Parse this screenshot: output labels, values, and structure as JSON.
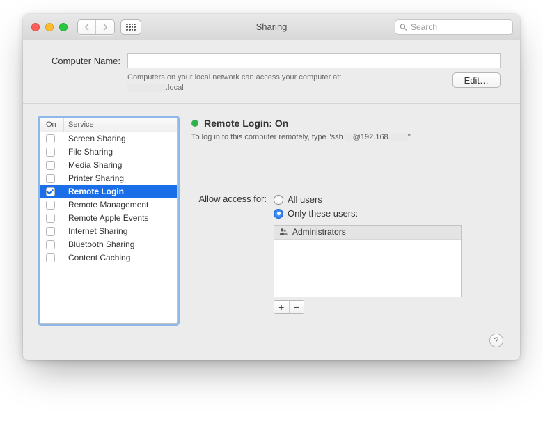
{
  "window": {
    "title": "Sharing"
  },
  "toolbar": {
    "search_placeholder": "Search"
  },
  "name_section": {
    "label": "Computer Name:",
    "value": "",
    "hint_line1": "Computers on your local network can access your computer at:",
    "hint_line2": ".local",
    "edit_label": "Edit…"
  },
  "service_list": {
    "col_on": "On",
    "col_service": "Service",
    "items": [
      {
        "label": "Screen Sharing",
        "on": false,
        "selected": false
      },
      {
        "label": "File Sharing",
        "on": false,
        "selected": false
      },
      {
        "label": "Media Sharing",
        "on": false,
        "selected": false
      },
      {
        "label": "Printer Sharing",
        "on": false,
        "selected": false
      },
      {
        "label": "Remote Login",
        "on": true,
        "selected": true
      },
      {
        "label": "Remote Management",
        "on": false,
        "selected": false
      },
      {
        "label": "Remote Apple Events",
        "on": false,
        "selected": false
      },
      {
        "label": "Internet Sharing",
        "on": false,
        "selected": false
      },
      {
        "label": "Bluetooth Sharing",
        "on": false,
        "selected": false
      },
      {
        "label": "Content Caching",
        "on": false,
        "selected": false
      }
    ]
  },
  "detail": {
    "status_color": "green",
    "status_text": "Remote Login: On",
    "instruction_prefix": "To log in to this computer remotely, type \"ssh ",
    "instruction_mid": "@192.168.",
    "instruction_suffix": "\"",
    "access_label": "Allow access for:",
    "radio_all": "All users",
    "radio_only": "Only these users:",
    "radio_selected": "only",
    "users": [
      {
        "label": "Administrators"
      }
    ]
  },
  "glyphs": {
    "plus": "+",
    "minus": "−",
    "help": "?"
  }
}
